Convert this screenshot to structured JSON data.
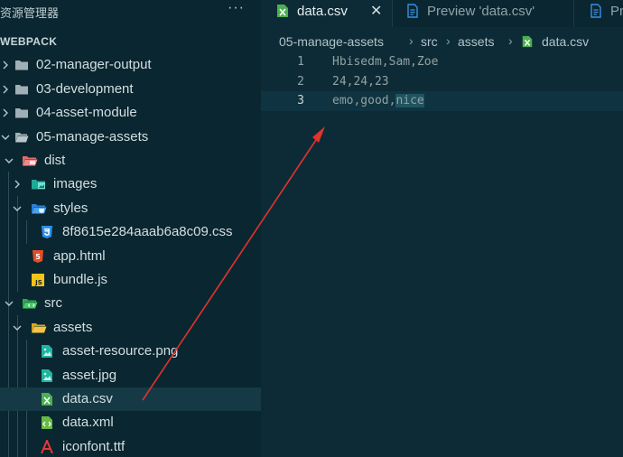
{
  "sidebar": {
    "title": "资源管理器",
    "more_label": "···",
    "workspace": "WEBPACK",
    "items": [
      {
        "label": "02-manager-output",
        "kind": "folder"
      },
      {
        "label": "03-development",
        "kind": "folder"
      },
      {
        "label": "04-asset-module",
        "kind": "folder"
      },
      {
        "label": "05-manage-assets",
        "kind": "folder-open"
      },
      {
        "label": "dist",
        "kind": "folder-dist"
      },
      {
        "label": "images",
        "kind": "folder-images"
      },
      {
        "label": "styles",
        "kind": "folder-styles"
      },
      {
        "label": "8f8615e284aaab6a8c09.css",
        "kind": "css-file"
      },
      {
        "label": "app.html",
        "kind": "html-file"
      },
      {
        "label": "bundle.js",
        "kind": "js-file"
      },
      {
        "label": "src",
        "kind": "folder-src"
      },
      {
        "label": "assets",
        "kind": "folder-assets"
      },
      {
        "label": "asset-resource.png",
        "kind": "image-file"
      },
      {
        "label": "asset.jpg",
        "kind": "image-file"
      },
      {
        "label": "data.csv",
        "kind": "csv-file",
        "selected": true
      },
      {
        "label": "data.xml",
        "kind": "xml-file"
      },
      {
        "label": "iconfont.ttf",
        "kind": "font-file"
      }
    ]
  },
  "tabs": [
    {
      "label": "data.csv",
      "icon": "csv-file-icon",
      "active": true,
      "close_label": "✕"
    },
    {
      "label": "Preview 'data.csv'",
      "icon": "preview-icon",
      "active": false
    },
    {
      "label": "Pr",
      "icon": "preview-icon",
      "active": false
    }
  ],
  "breadcrumb": {
    "parts": [
      "05-manage-assets",
      "src",
      "assets",
      "data.csv"
    ],
    "separator": "›"
  },
  "editor": {
    "lines": [
      {
        "num": "1",
        "text": "Hbisedm,Sam,Zoe"
      },
      {
        "num": "2",
        "text": "24,24,23"
      },
      {
        "num": "3",
        "pre": "emo,good,",
        "highlighted": "nice"
      }
    ]
  },
  "colors": {
    "sidebar_bg": "#0a2630",
    "editor_bg": "#0d2b36",
    "selection": "#153a46",
    "annotation_arrow": "#e0332b"
  }
}
